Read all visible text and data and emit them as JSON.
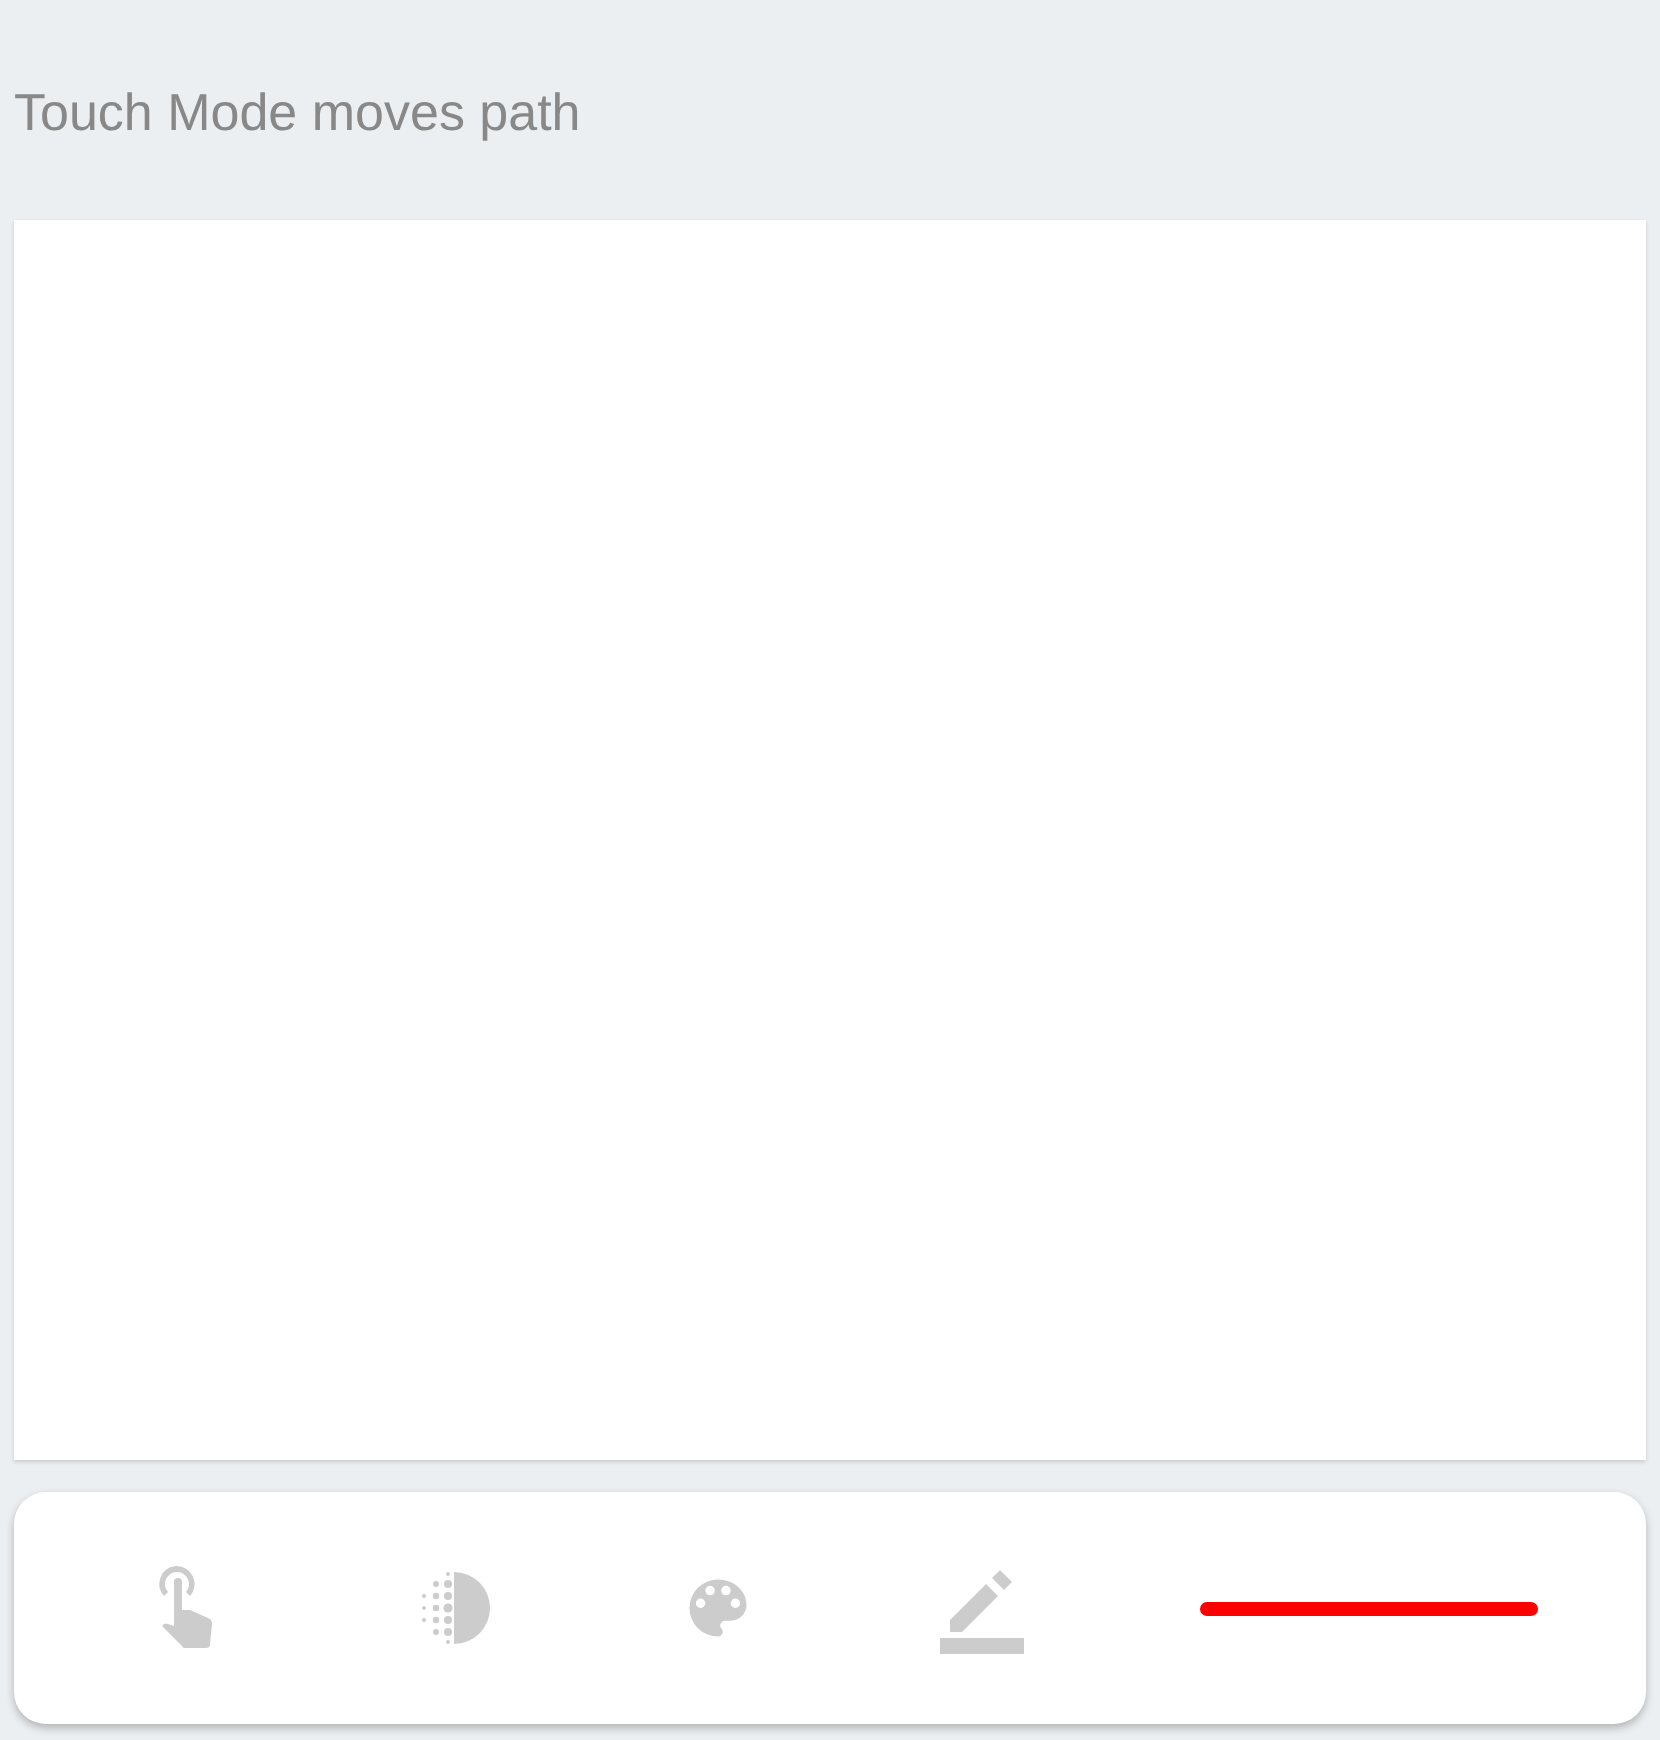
{
  "status_text": "Touch Mode moves path",
  "toolbar": {
    "tools": [
      {
        "kind": "touch"
      },
      {
        "kind": "opacity"
      },
      {
        "kind": "palette"
      },
      {
        "kind": "edit"
      }
    ],
    "stroke": {
      "color": "#ff0000"
    }
  }
}
